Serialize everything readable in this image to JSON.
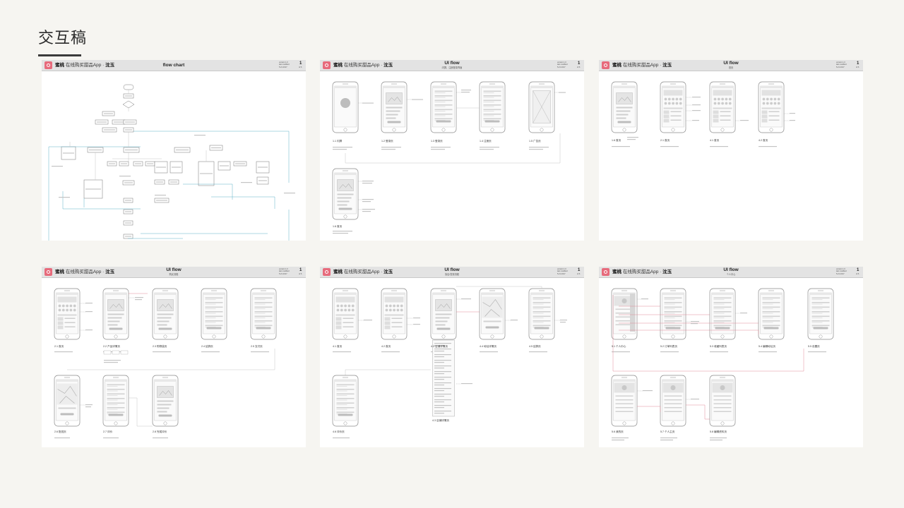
{
  "page": {
    "title": "交互稿"
  },
  "header": {
    "brand_name": "蜜桃",
    "brand_desc": "在线购买甜品App ·",
    "author": "沈玉",
    "version_text": "version 1.0\nlast modified\n5.21.2017",
    "page_label": "of 6"
  },
  "panels": [
    {
      "title": "flow chart",
      "subtitle": "",
      "page_no": "1"
    },
    {
      "title": "UI flow",
      "subtitle": "闪屏、注册登录界面",
      "page_no": "1",
      "screens": [
        "1.1 闪屏",
        "1.2 登录页",
        "1.3 登录页",
        "1.4 注册页",
        "1.5 广告页",
        "1.6 首页"
      ]
    },
    {
      "title": "UI flow",
      "subtitle": "首页",
      "page_no": "1",
      "screens": [
        "1.6 首页",
        "2.1 首页",
        "4.1 首页",
        "4.2 首页"
      ]
    },
    {
      "title": "UI flow",
      "subtitle": "购买流程",
      "page_no": "1",
      "screens": [
        "2.1 首页",
        "2.2 产品详情页",
        "2.3 购物袋页",
        "2.4 结算页",
        "2.5 支付页",
        "2.6 配送页",
        "2.7 评价",
        "2.8 完成评价"
      ]
    },
    {
      "title": "UI flow",
      "subtitle": "探店/发现流程",
      "page_no": "1",
      "screens": [
        "4.1 首页",
        "4.2 首页",
        "4.3 店铺详情页",
        "4.4 地址详情页",
        "4.5 结算页",
        "4.6 评价页"
      ]
    },
    {
      "title": "UI flow",
      "subtitle": "个人中心",
      "page_no": "1",
      "screens": [
        "5.1 个人中心",
        "5.2 订单列表页",
        "5.3 收藏列表页",
        "5.4 编辑地址页",
        "5.5 设置页",
        "5.6 我的页",
        "5.7 个人主页",
        "5.8 编辑资料页"
      ]
    }
  ]
}
